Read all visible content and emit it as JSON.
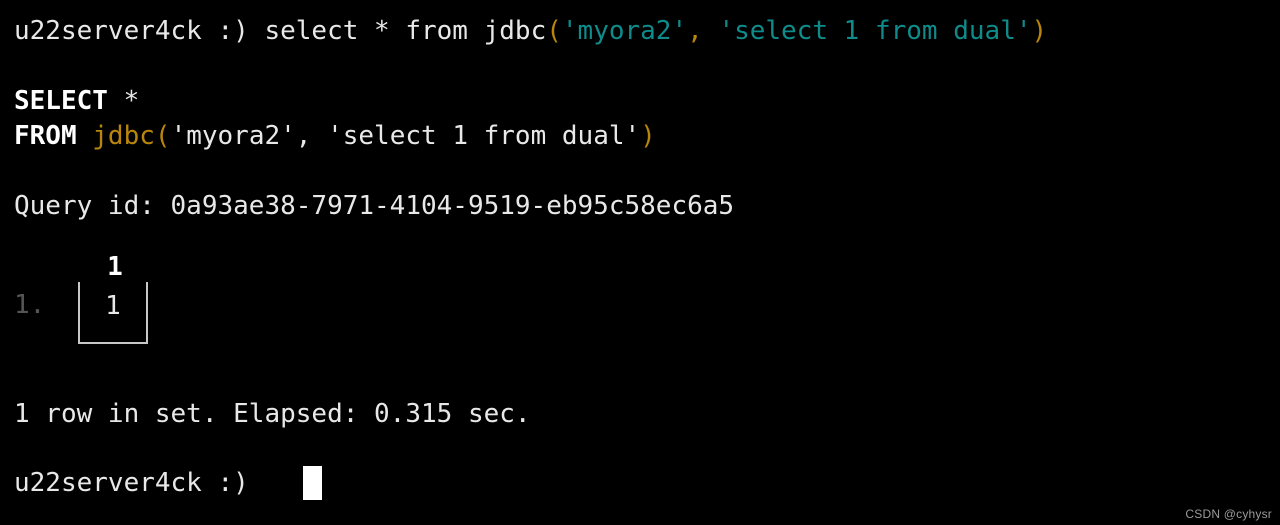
{
  "terminal": {
    "background_color": "#000000",
    "foreground_color": "#e8e8e8",
    "prompt": "u22server4ck :)",
    "colors": {
      "string_literal": "#0e8b8b",
      "paren": "#b8860b",
      "function": "#b8860b",
      "keyword": "#ffffff",
      "dim": "#555555",
      "border": "#c8c8c8"
    }
  },
  "command_line": {
    "prompt": "u22server4ck :)",
    "space": " ",
    "sql_head": "select * from jdbc",
    "open_paren": "(",
    "arg1": "'myora2'",
    "comma": ",",
    "arg_space": " ",
    "arg2": "'select 1 from dual'",
    "close_paren": ")"
  },
  "formatted_query": {
    "select_keyword": "SELECT",
    "select_rest": " *",
    "from_keyword": "FROM",
    "from_space": " ",
    "function_name": "jdbc",
    "open_paren": "(",
    "arg1": "'myora2', 'select 1 from dual'",
    "close_paren": ")"
  },
  "query_id_line": "Query id: 0a93ae38-7971-4104-9519-eb95c58ec6a5",
  "result": {
    "row_number_label": "1.",
    "columns": [
      "1"
    ],
    "rows": [
      [
        "1"
      ]
    ]
  },
  "status_line": "1 row in set. Elapsed: 0.315 sec.",
  "final_prompt": "u22server4ck :)",
  "cursor": {
    "shape": "block",
    "color": "#ffffff"
  },
  "watermark": "CSDN @cyhysr"
}
